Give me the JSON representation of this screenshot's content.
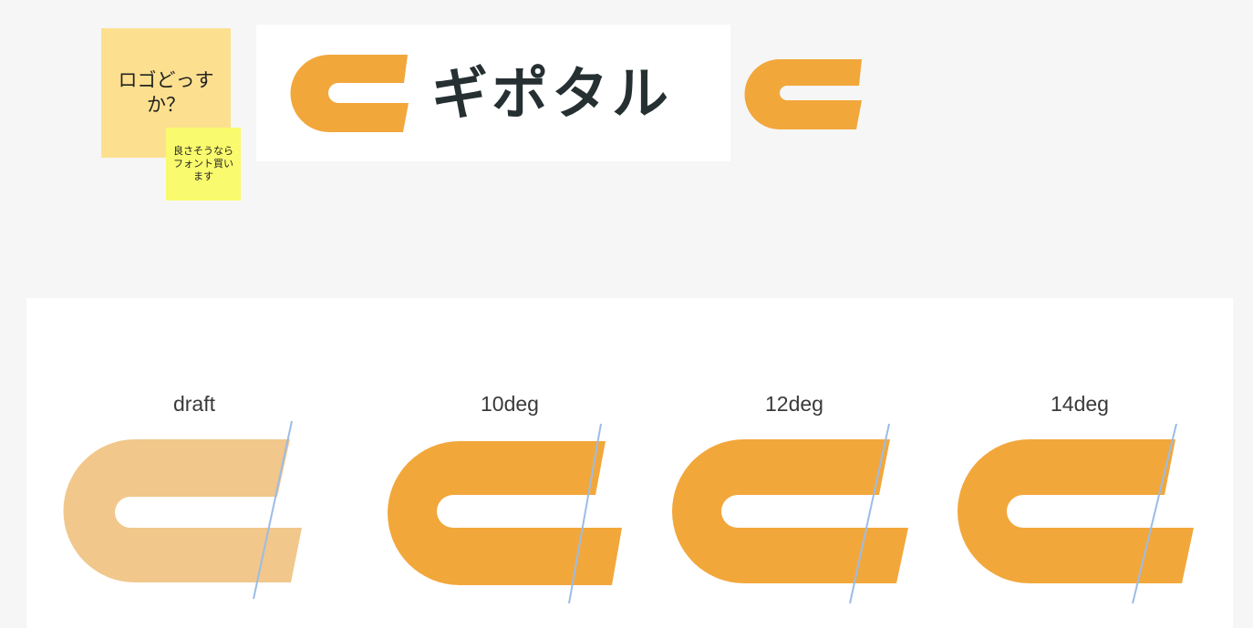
{
  "stickies": {
    "main_text": "ロゴどっすか？",
    "small_text": "良さそうならフォント買います"
  },
  "logo": {
    "wordmark": "ギポタル",
    "mark_icon": "g-logo-icon",
    "brand_color": "#f2a73b",
    "wordmark_color": "#263033"
  },
  "variants": [
    {
      "label": "draft",
      "color": "#f1c78b"
    },
    {
      "label": "10deg",
      "color": "#f2a73b"
    },
    {
      "label": "12deg",
      "color": "#f2a73b"
    },
    {
      "label": "14deg",
      "color": "#f2a73b"
    }
  ],
  "guide_line_color": "#9bbce6"
}
